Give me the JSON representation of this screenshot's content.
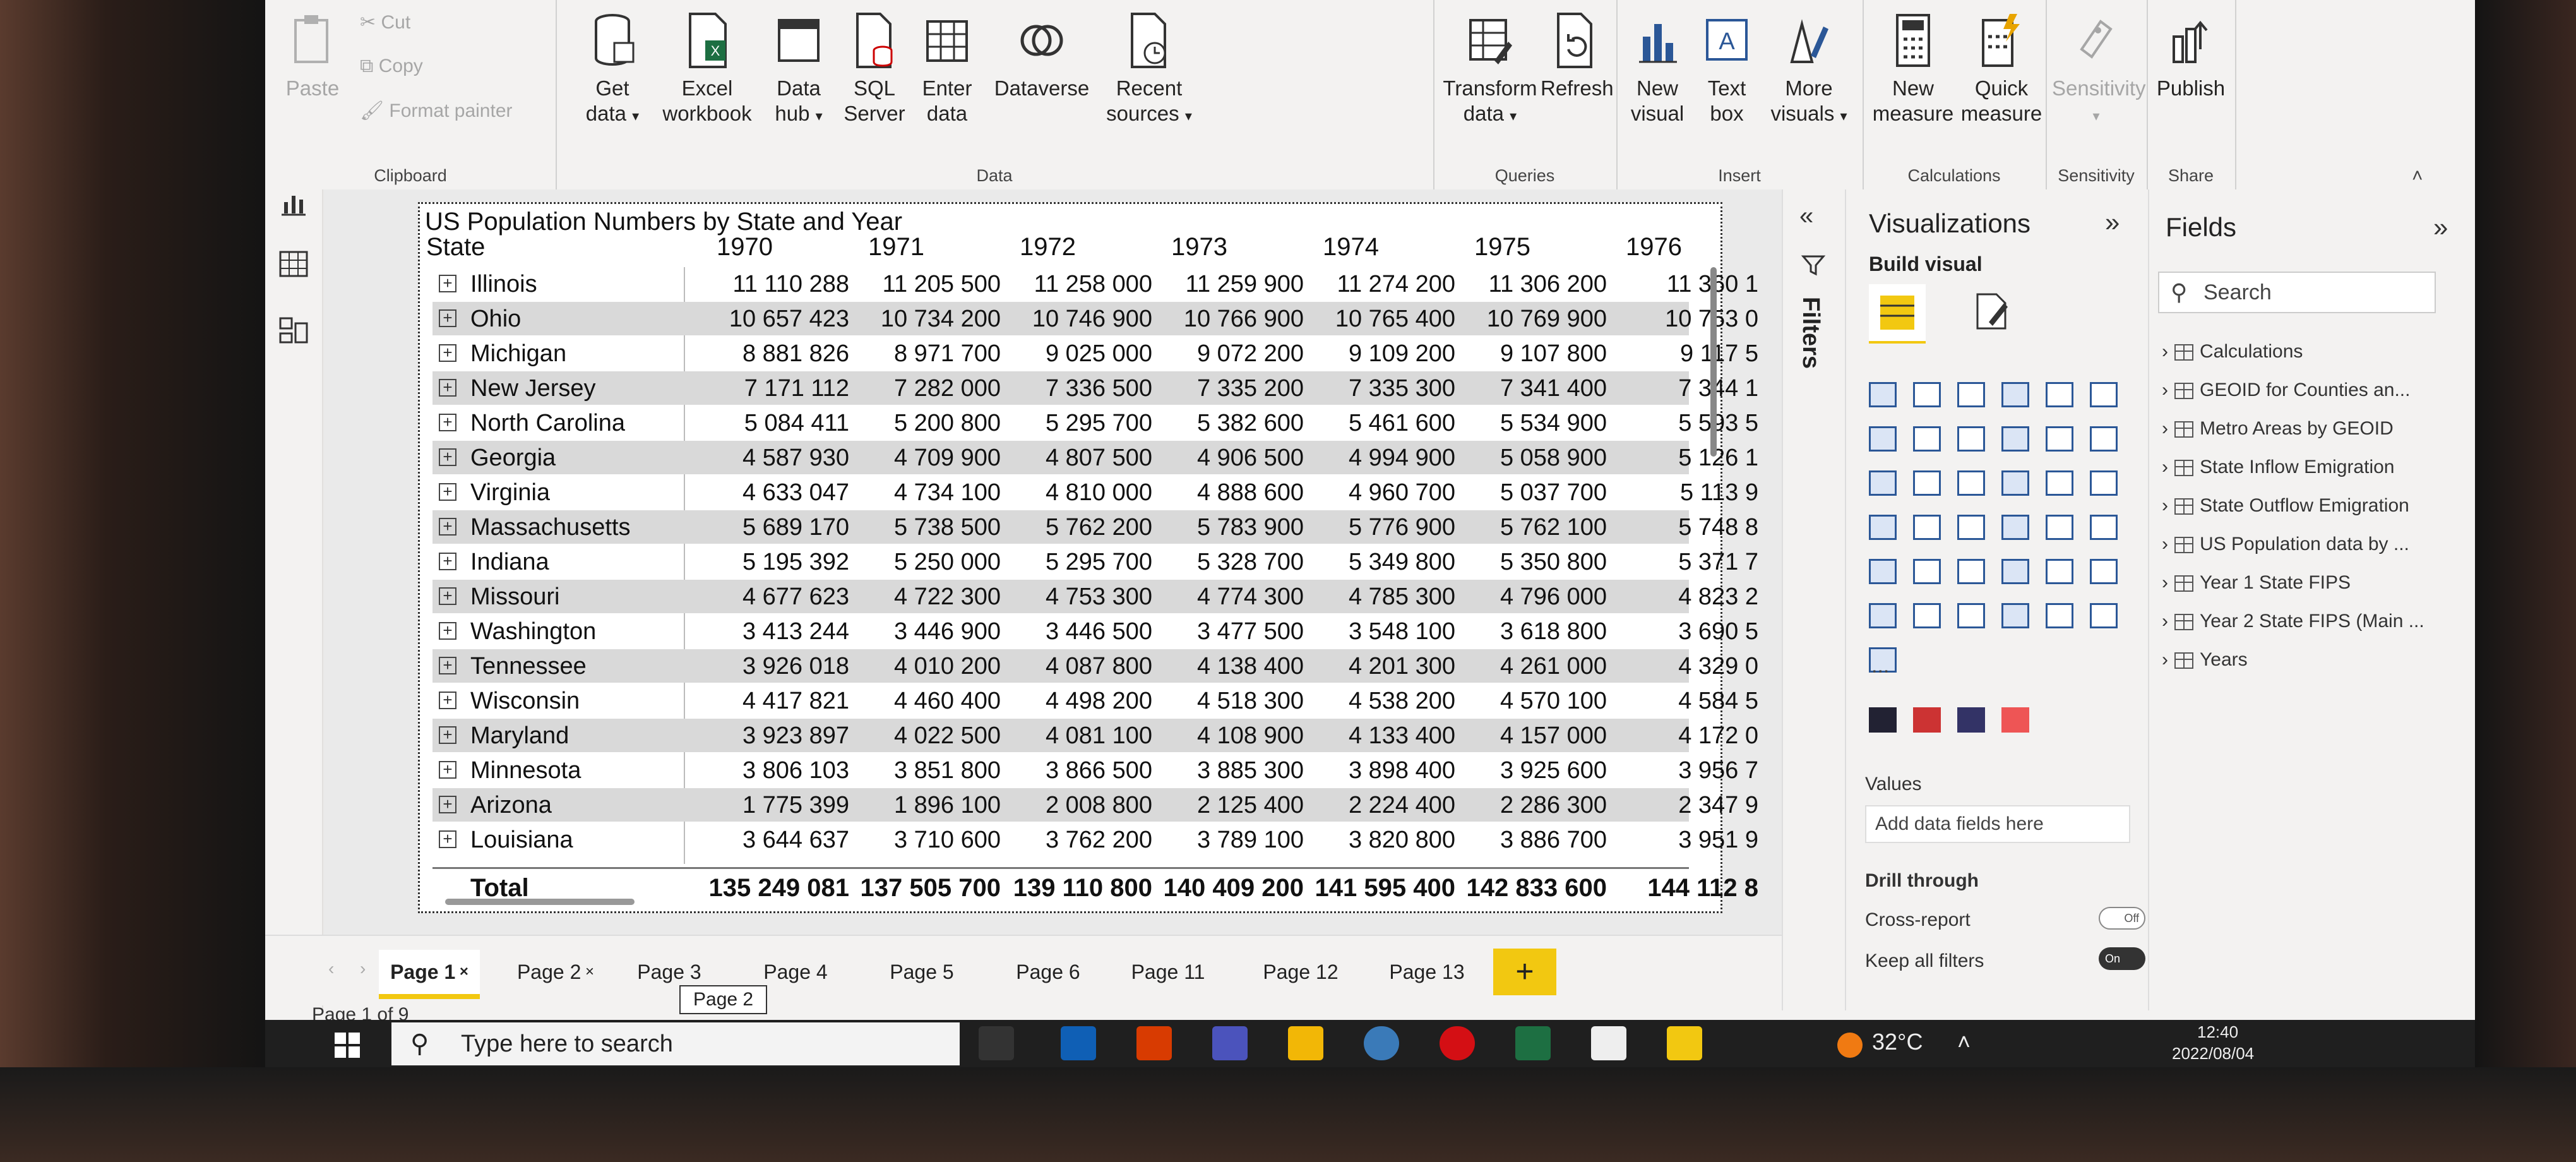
{
  "ribbon": {
    "clipboard": {
      "paste": "Paste",
      "cut": "Cut",
      "copy": "Copy",
      "format_painter": "Format painter",
      "group": "Clipboard"
    },
    "data": {
      "get_data": "Get data",
      "excel": "Excel workbook",
      "data_hub": "Data hub",
      "sql": "SQL Server",
      "enter": "Enter data",
      "dataverse": "Dataverse",
      "recent": "Recent sources",
      "group": "Data"
    },
    "queries": {
      "transform": "Transform data",
      "refresh": "Refresh",
      "group": "Queries"
    },
    "insert": {
      "new_visual": "New visual",
      "text_box": "Text box",
      "more_visuals": "More visuals",
      "group": "Insert"
    },
    "calculations": {
      "new_measure": "New measure",
      "quick_measure": "Quick measure",
      "group": "Calculations"
    },
    "sensitivity": {
      "label": "Sensitivity",
      "group": "Sensitivity"
    },
    "share": {
      "publish": "Publish",
      "group": "Share"
    }
  },
  "table": {
    "title": "US Population Numbers by State and Year",
    "state_header": "State",
    "years": [
      "1970",
      "1971",
      "1972",
      "1973",
      "1974",
      "1975",
      "1976"
    ],
    "rows": [
      {
        "state": "Illinois",
        "values": [
          "11 110 288",
          "11 205 500",
          "11 258 000",
          "11 259 900",
          "11 274 200",
          "11 306 200",
          "11 360 1"
        ]
      },
      {
        "state": "Ohio",
        "values": [
          "10 657 423",
          "10 734 200",
          "10 746 900",
          "10 766 900",
          "10 765 400",
          "10 769 900",
          "10 753 0"
        ]
      },
      {
        "state": "Michigan",
        "values": [
          "8 881 826",
          "8 971 700",
          "9 025 000",
          "9 072 200",
          "9 109 200",
          "9 107 800",
          "9 117 5"
        ]
      },
      {
        "state": "New Jersey",
        "values": [
          "7 171 112",
          "7 282 000",
          "7 336 500",
          "7 335 200",
          "7 335 300",
          "7 341 400",
          "7 344 1"
        ]
      },
      {
        "state": "North Carolina",
        "values": [
          "5 084 411",
          "5 200 800",
          "5 295 700",
          "5 382 600",
          "5 461 600",
          "5 534 900",
          "5 593 5"
        ]
      },
      {
        "state": "Georgia",
        "values": [
          "4 587 930",
          "4 709 900",
          "4 807 500",
          "4 906 500",
          "4 994 900",
          "5 058 900",
          "5 126 1"
        ]
      },
      {
        "state": "Virginia",
        "values": [
          "4 633 047",
          "4 734 100",
          "4 810 000",
          "4 888 600",
          "4 960 700",
          "5 037 700",
          "5 113 9"
        ]
      },
      {
        "state": "Massachusetts",
        "values": [
          "5 689 170",
          "5 738 500",
          "5 762 200",
          "5 783 900",
          "5 776 900",
          "5 762 100",
          "5 748 8"
        ]
      },
      {
        "state": "Indiana",
        "values": [
          "5 195 392",
          "5 250 000",
          "5 295 700",
          "5 328 700",
          "5 349 800",
          "5 350 800",
          "5 371 7"
        ]
      },
      {
        "state": "Missouri",
        "values": [
          "4 677 623",
          "4 722 300",
          "4 753 300",
          "4 774 300",
          "4 785 300",
          "4 796 000",
          "4 823 2"
        ]
      },
      {
        "state": "Washington",
        "values": [
          "3 413 244",
          "3 446 900",
          "3 446 500",
          "3 477 500",
          "3 548 100",
          "3 618 800",
          "3 690 5"
        ]
      },
      {
        "state": "Tennessee",
        "values": [
          "3 926 018",
          "4 010 200",
          "4 087 800",
          "4 138 400",
          "4 201 300",
          "4 261 000",
          "4 329 0"
        ]
      },
      {
        "state": "Wisconsin",
        "values": [
          "4 417 821",
          "4 460 400",
          "4 498 200",
          "4 518 300",
          "4 538 200",
          "4 570 100",
          "4 584 5"
        ]
      },
      {
        "state": "Maryland",
        "values": [
          "3 923 897",
          "4 022 500",
          "4 081 100",
          "4 108 900",
          "4 133 400",
          "4 157 000",
          "4 172 0"
        ]
      },
      {
        "state": "Minnesota",
        "values": [
          "3 806 103",
          "3 851 800",
          "3 866 500",
          "3 885 300",
          "3 898 400",
          "3 925 600",
          "3 956 7"
        ]
      },
      {
        "state": "Arizona",
        "values": [
          "1 775 399",
          "1 896 100",
          "2 008 800",
          "2 125 400",
          "2 224 400",
          "2 286 300",
          "2 347 9"
        ]
      },
      {
        "state": "Louisiana",
        "values": [
          "3 644 637",
          "3 710 600",
          "3 762 200",
          "3 789 100",
          "3 820 800",
          "3 886 700",
          "3 951 9"
        ]
      }
    ],
    "total_label": "Total",
    "totals": [
      "135 249 081",
      "137 505 700",
      "139 110 800",
      "140 409 200",
      "141 595 400",
      "142 833 600",
      "144 112 8"
    ]
  },
  "filters": {
    "label": "Filters"
  },
  "visualizations": {
    "title": "Visualizations",
    "build_visual": "Build visual",
    "more": "...",
    "values": "Values",
    "add_fields": "Add data fields here",
    "drill_through": "Drill through",
    "cross_report": "Cross-report",
    "cross_report_state": "Off",
    "keep_filters": "Keep all filters",
    "keep_filters_state": "On"
  },
  "fields": {
    "title": "Fields",
    "search_placeholder": "Search",
    "items": [
      "Calculations",
      "GEOID for Counties an...",
      "Metro Areas by GEOID",
      "State Inflow Emigration",
      "State Outflow Emigration",
      "US Population data by ...",
      "Year 1 State FIPS",
      "Year 2 State FIPS (Main ...",
      "Years"
    ]
  },
  "pages": {
    "tabs": [
      "Page 1",
      "Page 2",
      "Page 3",
      "Page 4",
      "Page 5",
      "Page 6",
      "Page 11",
      "Page 12",
      "Page 13"
    ],
    "active": "Page 1",
    "tooltip": "Page 2",
    "add": "+",
    "status": "Page 1 of 9"
  },
  "taskbar": {
    "search_placeholder": "Type here to search",
    "temperature": "32°C",
    "time": "12:40",
    "date": "2022/08/04"
  },
  "colors": {
    "accent": "#f2c811",
    "excel_green": "#1d6f42",
    "opera_red": "#d40f14"
  }
}
